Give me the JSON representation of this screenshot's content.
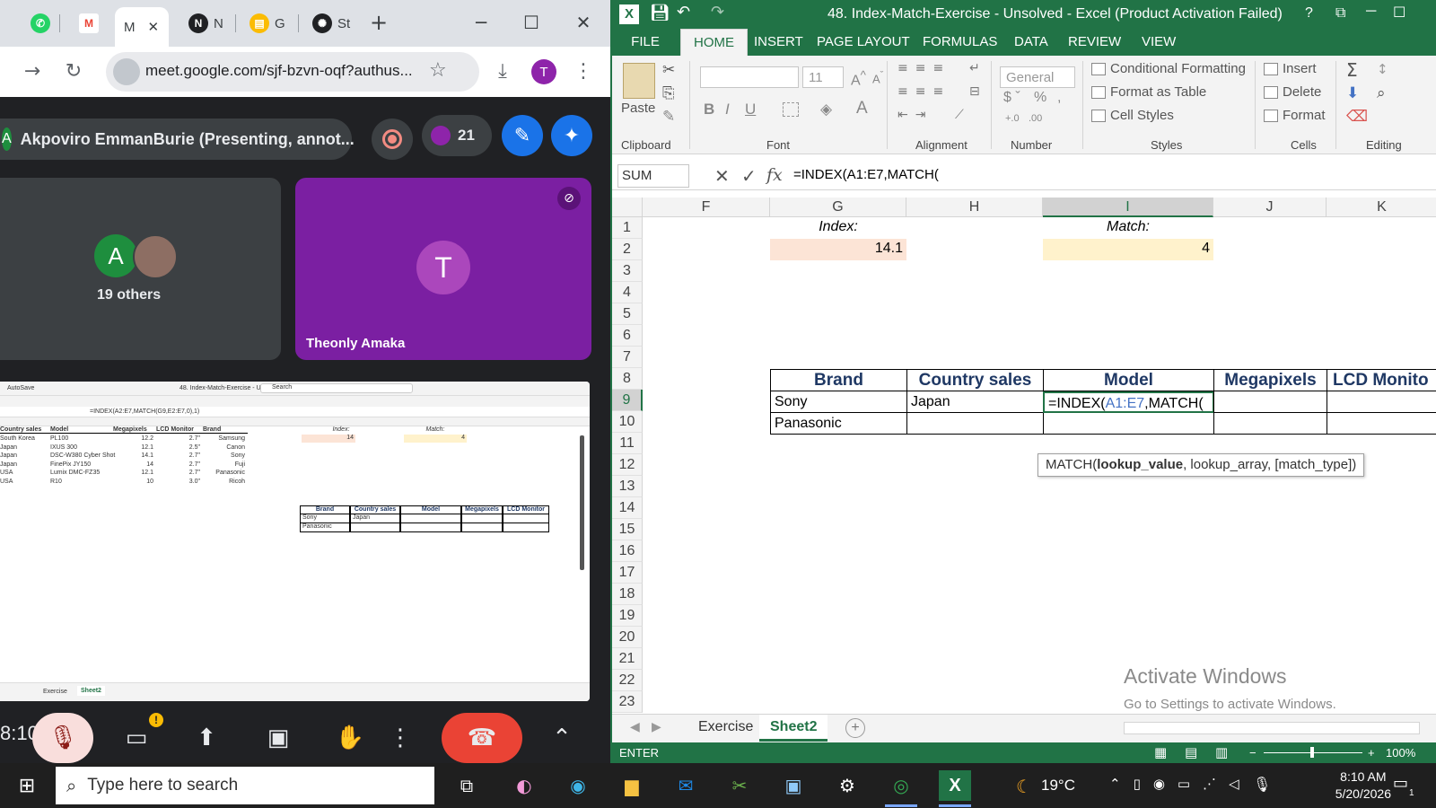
{
  "chrome": {
    "tabs": [
      {
        "icon": "whatsapp-icon",
        "label": ""
      },
      {
        "icon": "gmail-icon",
        "label": ""
      },
      {
        "icon": "meet-icon",
        "label": "M"
      },
      {
        "icon": "notion-icon",
        "label": "N"
      },
      {
        "icon": "google-icon",
        "label": "G"
      },
      {
        "icon": "chatgpt-icon",
        "label": "St"
      }
    ],
    "url": "meet.google.com/sjf-bzvn-oqf?authus...",
    "profile_initial": "T"
  },
  "meet": {
    "presenter_initial": "A",
    "presenter_label": "Akpoviro EmmanBurie (Presenting, annot...",
    "participant_count": "21",
    "others_initial": "A",
    "others_label": "19 others",
    "tile_initial": "T",
    "tile_name": "Theonly Amaka",
    "clock_partial": "8:10",
    "colors": {
      "tile": "#7b1fa2",
      "avatar": "#ab47bc",
      "end_call": "#ea4335",
      "green": "#1e8e3e"
    }
  },
  "preview": {
    "formula": "=INDEX(A2:E7,MATCH(G9,E2:E7,0),1)",
    "search": "Search",
    "title": "48. Index-Match-Exercise - Unso...",
    "headers": [
      "Country sales",
      "Model",
      "Megapixels",
      "LCD Monitor",
      "Brand"
    ],
    "rows": [
      [
        "South Korea",
        "PL100",
        "12.2",
        "2.7\"",
        "Samsung"
      ],
      [
        "Japan",
        "IXUS 300",
        "12.1",
        "2.5\"",
        "Canon"
      ],
      [
        "Japan",
        "DSC-W380 Cyber Shot",
        "14.1",
        "2.7\"",
        "Sony"
      ],
      [
        "Japan",
        "FinePix JY150",
        "14",
        "2.7\"",
        "Fuji"
      ],
      [
        "USA",
        "Lumix DMC-FZ35",
        "12.1",
        "2.7\"",
        "Panasonic"
      ],
      [
        "USA",
        "R10",
        "10",
        "3.0\"",
        "Ricoh"
      ]
    ],
    "index_label": "Index:",
    "index_value": "14",
    "match_label": "Match:",
    "match_value": "4",
    "table_headers": [
      "Brand",
      "Country sales",
      "Model",
      "Megapixels",
      "LCD Monitor"
    ],
    "table_rows": [
      [
        "Sony",
        "Japan",
        "",
        "",
        ""
      ],
      [
        "Panasonic",
        "",
        "",
        "",
        ""
      ]
    ],
    "sheets": [
      "Exercise",
      "Sheet2"
    ]
  },
  "excel": {
    "title": "48. Index-Match-Exercise - Unsolved - Excel (Product Activation Failed)",
    "ribbon_tabs": [
      "FILE",
      "HOME",
      "INSERT",
      "PAGE LAYOUT",
      "FORMULAS",
      "DATA",
      "REVIEW",
      "VIEW"
    ],
    "groups": {
      "clipboard": "Clipboard",
      "font": "Font",
      "alignment": "Alignment",
      "number": "Number",
      "styles": "Styles",
      "cells": "Cells",
      "editing": "Editing"
    },
    "paste": "Paste",
    "font_size": "11",
    "number_format": "General",
    "styles": [
      "Conditional Formatting",
      "Format as Table",
      "Cell Styles"
    ],
    "cells": [
      "Insert",
      "Delete",
      "Format"
    ],
    "name_box": "SUM",
    "formula": "=INDEX(A1:E7,MATCH(",
    "columns": [
      "F",
      "G",
      "H",
      "I",
      "J",
      "K"
    ],
    "rows": [
      "1",
      "2",
      "3",
      "4",
      "5",
      "6",
      "7",
      "8",
      "9",
      "10",
      "11",
      "12",
      "13",
      "14",
      "15",
      "16",
      "17",
      "18",
      "19",
      "20",
      "21",
      "22",
      "23"
    ],
    "index_label": "Index:",
    "index_value": "14.1",
    "match_label": "Match:",
    "match_value": "4",
    "table_headers": [
      "Brand",
      "Country sales",
      "Model",
      "Megapixels",
      "LCD Monito"
    ],
    "row9": {
      "brand": "Sony",
      "country": "Japan",
      "edit_pre": "=INDEX(",
      "edit_ref": "A1:E7",
      "edit_post": ",MATCH("
    },
    "row10": {
      "brand": "Panasonic"
    },
    "tooltip": {
      "fn": "MATCH(",
      "bold": "lookup_value",
      "rest": ", lookup_array, [match_type])"
    },
    "sheets": [
      "Exercise",
      "Sheet2"
    ],
    "status": "ENTER",
    "zoom": "100%",
    "watermark_title": "Activate Windows",
    "watermark_sub": "Go to Settings to activate Windows.",
    "colors": {
      "brand_green": "#217346",
      "index_fill": "#fce4d6",
      "match_fill": "#fff2cc",
      "header_text": "#1f3864",
      "ref_blue": "#4472c4"
    }
  },
  "taskbar": {
    "search_placeholder": "Type here to search",
    "weather": "19°C",
    "time": "8:10 AM",
    "date": "5/20/2026",
    "notif_count": "1"
  }
}
